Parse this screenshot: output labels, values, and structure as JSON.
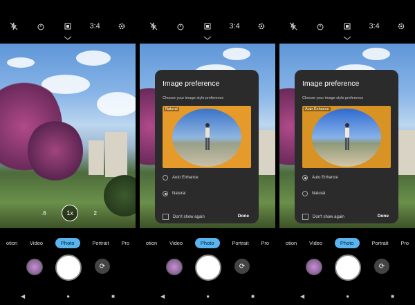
{
  "screens": [
    {
      "modes": [
        "otion",
        "Video",
        "Photo",
        "Portrait",
        "Pro"
      ],
      "active_mode": "Photo",
      "zoom": {
        "left": ".6",
        "center": "1x",
        "right": "2"
      }
    },
    {
      "modes": [
        "otion",
        "Video",
        "Photo",
        "Portrait",
        "Pro"
      ],
      "active_mode": "Photo",
      "dialog": {
        "title": "Image preference",
        "subtitle": "Choose your image style preference",
        "image_label": "Natural",
        "option1": "Auto Enhance",
        "option2": "Natural",
        "selected": "Natural",
        "checkbox": "Don't show again",
        "done": "Done"
      }
    },
    {
      "modes": [
        "otion",
        "Video",
        "Photo",
        "Portrait",
        "Pro"
      ],
      "active_mode": "Photo",
      "dialog": {
        "title": "Image preference",
        "subtitle": "Choose your image style preference",
        "image_label": "Auto Enhance",
        "option1": "Auto Enhance",
        "option2": "Natural",
        "selected": "Auto Enhance",
        "checkbox": "Don't show again",
        "done": "Done"
      }
    }
  ],
  "topbar_icons": [
    "flash-off-icon",
    "timer-icon",
    "settings-photo-icon",
    "aspect-ratio-icon",
    "gear-icon"
  ],
  "topbar_text": {
    "ratio": "3:4"
  },
  "colors": {
    "accent": "#5ab4f0",
    "dialog_bg": "#2b2b2b"
  }
}
